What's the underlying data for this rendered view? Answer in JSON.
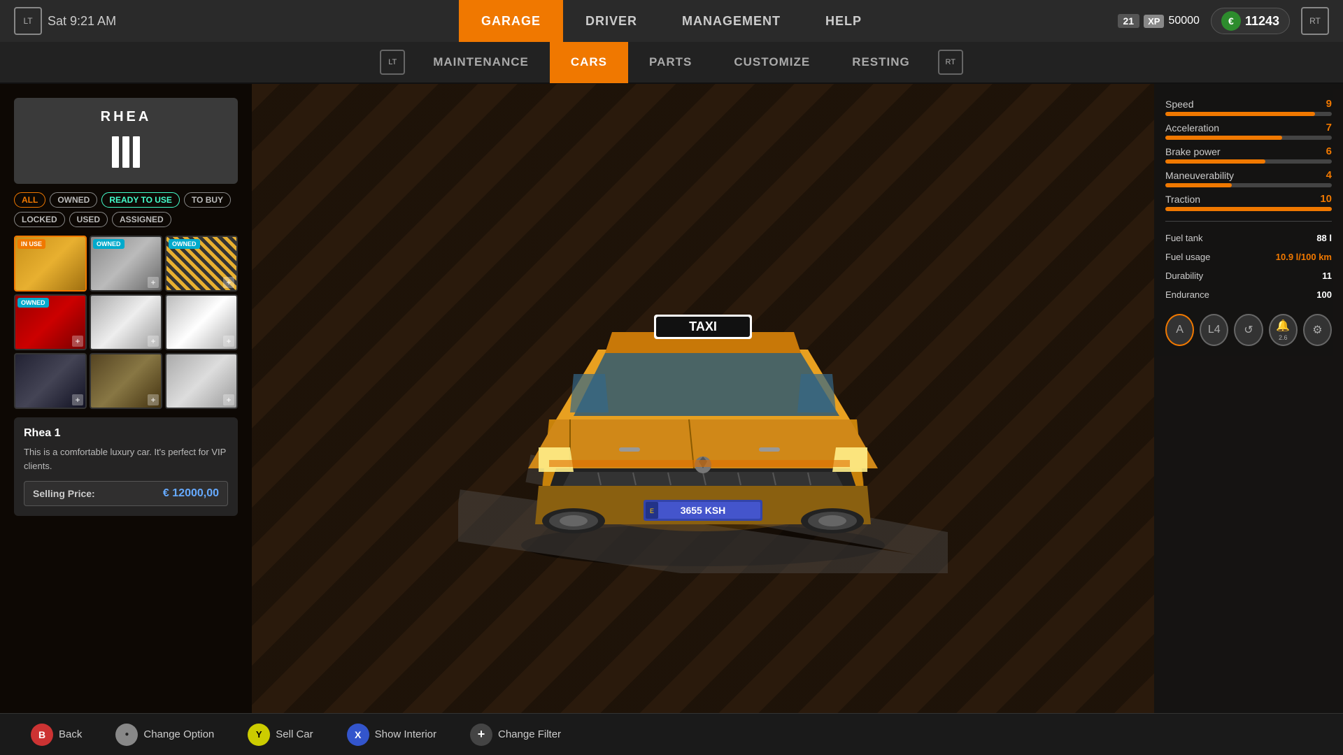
{
  "topbar": {
    "datetime": "Sat  9:21 AM",
    "lt_icon": "LT",
    "rt_icon": "RT",
    "xp_level": "21",
    "xp_label": "XP",
    "xp_value": "50000",
    "money": "11243",
    "euro_sign": "€"
  },
  "main_nav": {
    "items": [
      {
        "label": "GARAGE",
        "active": true
      },
      {
        "label": "DRIVER",
        "active": false
      },
      {
        "label": "MANAGEMENT",
        "active": false
      },
      {
        "label": "HELP",
        "active": false
      }
    ]
  },
  "sub_nav": {
    "lt_icon": "LT",
    "rt_icon": "RT",
    "items": [
      {
        "label": "MAINTENANCE",
        "active": false
      },
      {
        "label": "CARS",
        "active": true
      },
      {
        "label": "PARTS",
        "active": false
      },
      {
        "label": "CUSTOMIZE",
        "active": false
      },
      {
        "label": "RESTING",
        "active": false
      }
    ]
  },
  "car_brand": {
    "name": "RHEA"
  },
  "filter_tags": [
    {
      "label": "ALL",
      "type": "normal"
    },
    {
      "label": "OWNED",
      "type": "normal"
    },
    {
      "label": "READY TO USE",
      "type": "ready"
    },
    {
      "label": "TO BUY",
      "type": "normal"
    },
    {
      "label": "LOCKED",
      "type": "normal"
    },
    {
      "label": "USED",
      "type": "normal"
    },
    {
      "label": "ASSIGNED",
      "type": "normal"
    }
  ],
  "car_grid": [
    {
      "badge": "IN USE",
      "badge_type": "inuse",
      "color": "ct-yellow",
      "plus": false,
      "selected": true
    },
    {
      "badge": "OWNED",
      "badge_type": "owned",
      "color": "ct-silver",
      "plus": true,
      "selected": false
    },
    {
      "badge": "OWNED",
      "badge_type": "owned",
      "color": "ct-pattern",
      "plus": true,
      "selected": false
    },
    {
      "badge": "OWNED",
      "badge_type": "owned",
      "color": "ct-red",
      "plus": true,
      "selected": false
    },
    {
      "badge": "",
      "badge_type": "",
      "color": "ct-white",
      "plus": true,
      "selected": false
    },
    {
      "badge": "",
      "badge_type": "",
      "color": "ct-white2",
      "plus": true,
      "selected": false
    },
    {
      "badge": "",
      "badge_type": "",
      "color": "ct-darkblue",
      "plus": true,
      "selected": false
    },
    {
      "badge": "",
      "badge_type": "",
      "color": "ct-interior",
      "plus": true,
      "selected": false
    },
    {
      "badge": "",
      "badge_type": "",
      "color": "ct-white3",
      "plus": true,
      "selected": false
    }
  ],
  "car_info": {
    "name": "Rhea  1",
    "description": "This is a comfortable luxury car. It's perfect for VIP clients.",
    "selling_price_label": "Selling Price:",
    "selling_price_value": "€ 12000,00"
  },
  "car_stats": {
    "speed_label": "Speed",
    "speed_val": "9",
    "speed_pct": 90,
    "accel_label": "Acceleration",
    "accel_val": "7",
    "accel_pct": 70,
    "brake_label": "Brake power",
    "brake_val": "6",
    "brake_pct": 60,
    "maneuver_label": "Maneuverability",
    "maneuver_val": "4",
    "maneuver_pct": 40,
    "traction_label": "Traction",
    "traction_val": "10",
    "traction_pct": 100,
    "fuel_tank_label": "Fuel tank",
    "fuel_tank_val": "88 l",
    "fuel_usage_label": "Fuel usage",
    "fuel_usage_val": "10.9 l/100 km",
    "durability_label": "Durability",
    "durability_val": "11",
    "endurance_label": "Endurance",
    "endurance_val": "100"
  },
  "car_icons": [
    {
      "label": "A",
      "sublabel": "",
      "active": true
    },
    {
      "label": "L4",
      "sublabel": "",
      "active": false
    },
    {
      "label": "↺",
      "sublabel": "",
      "active": false
    },
    {
      "label": "🔔",
      "sublabel": "2.6",
      "active": false
    },
    {
      "label": "⚙",
      "sublabel": "",
      "active": false
    }
  ],
  "bottom_bar": {
    "actions": [
      {
        "btn_label": "B",
        "btn_class": "btn-b",
        "label": "Back"
      },
      {
        "btn_label": "●",
        "btn_class": "btn-y",
        "label": "Change Option"
      },
      {
        "btn_label": "Y",
        "btn_class": "btn-y",
        "label": "Sell Car"
      },
      {
        "btn_label": "X",
        "btn_class": "btn-x",
        "label": "Show Interior"
      },
      {
        "btn_label": "+",
        "btn_class": "btn-plus",
        "label": "Change Filter"
      }
    ]
  }
}
